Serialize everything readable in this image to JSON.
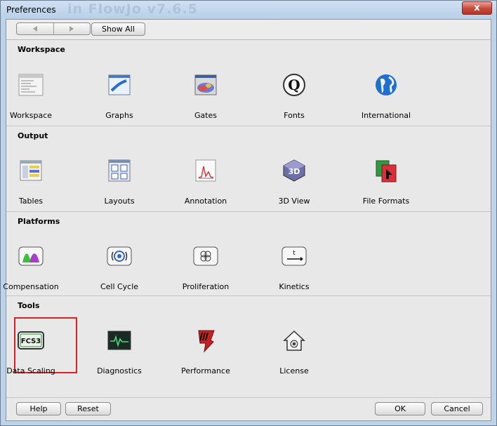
{
  "window": {
    "title": "Preferences",
    "background_title": "in FlowJo v7.6.5",
    "close_label": "x"
  },
  "toolbar": {
    "show_all_label": "Show All"
  },
  "sections": [
    {
      "header": "Workspace",
      "items": [
        {
          "label": "Workspace",
          "icon": "workspace-icon"
        },
        {
          "label": "Graphs",
          "icon": "graphs-icon"
        },
        {
          "label": "Gates",
          "icon": "gates-icon"
        },
        {
          "label": "Fonts",
          "icon": "fonts-icon"
        },
        {
          "label": "International",
          "icon": "globe-icon"
        }
      ]
    },
    {
      "header": "Output",
      "items": [
        {
          "label": "Tables",
          "icon": "tables-icon"
        },
        {
          "label": "Layouts",
          "icon": "layouts-icon"
        },
        {
          "label": "Annotation",
          "icon": "annotation-icon"
        },
        {
          "label": "3D View",
          "icon": "3d-view-icon"
        },
        {
          "label": "File Formats",
          "icon": "file-formats-icon"
        }
      ]
    },
    {
      "header": "Platforms",
      "items": [
        {
          "label": "Compensation",
          "icon": "compensation-icon"
        },
        {
          "label": "Cell Cycle",
          "icon": "cell-cycle-icon"
        },
        {
          "label": "Proliferation",
          "icon": "proliferation-icon"
        },
        {
          "label": "Kinetics",
          "icon": "kinetics-icon"
        }
      ]
    },
    {
      "header": "Tools",
      "items": [
        {
          "label": "Data Scaling",
          "icon": "fcs3-icon",
          "icon_text": "FCS3",
          "selected": true
        },
        {
          "label": "Diagnostics",
          "icon": "diagnostics-icon"
        },
        {
          "label": "Performance",
          "icon": "performance-icon"
        },
        {
          "label": "License",
          "icon": "license-icon"
        }
      ]
    }
  ],
  "footer": {
    "help_label": "Help",
    "reset_label": "Reset",
    "ok_label": "OK",
    "cancel_label": "Cancel"
  },
  "colors": {
    "window_frame": "#bcd3ea",
    "panel": "#e8e8e8",
    "selection": "#e02020"
  }
}
